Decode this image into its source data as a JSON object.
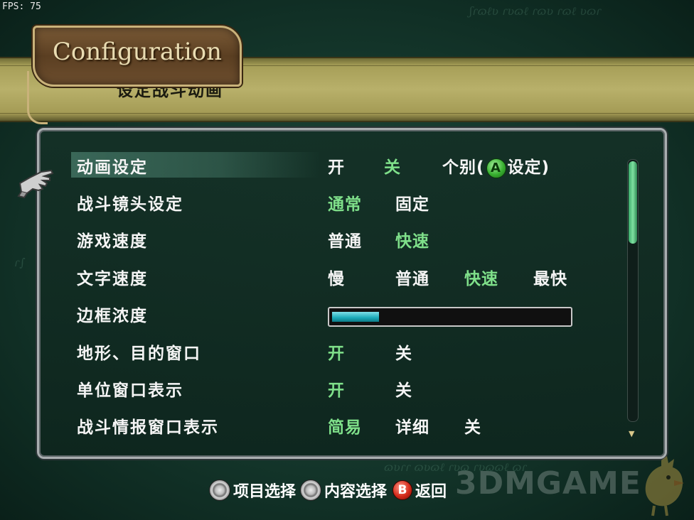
{
  "fps": "FPS: 75",
  "header": {
    "title": "Configuration",
    "subtitle": "设定战斗动画"
  },
  "settings": [
    {
      "label": "动画设定",
      "options": [
        "开",
        "关",
        "个别(",
        "设定)"
      ],
      "selected": "关"
    },
    {
      "label": "战斗镜头设定",
      "options": [
        "通常",
        "固定"
      ],
      "selected": "通常"
    },
    {
      "label": "游戏速度",
      "options": [
        "普通",
        "快速"
      ],
      "selected": "快速"
    },
    {
      "label": "文字速度",
      "options": [
        "慢",
        "普通",
        "快速",
        "最快"
      ],
      "selected": "快速"
    },
    {
      "label": "边框浓度",
      "slider_level": 0.2
    },
    {
      "label": "地形、目的窗口",
      "options": [
        "开",
        "关"
      ],
      "selected": "开"
    },
    {
      "label": "单位窗口表示",
      "options": [
        "开",
        "关"
      ],
      "selected": "开"
    },
    {
      "label": "战斗情报窗口表示",
      "options": [
        "简易",
        "详细",
        "关"
      ],
      "selected": "简易"
    }
  ],
  "buttons": {
    "a": "A",
    "b": "B"
  },
  "footer": {
    "item_select": "项目选择",
    "content_select": "内容选择",
    "back": "返回"
  },
  "scroll": {
    "position": 0.0,
    "visible_fraction": 0.32
  },
  "watermark": "3DMGAME",
  "colors": {
    "selected_option": "#7fe08a",
    "normal_option": "#f5f5f5",
    "slider_fill": "#1aa9b8",
    "header_band": "#b8b06a"
  }
}
